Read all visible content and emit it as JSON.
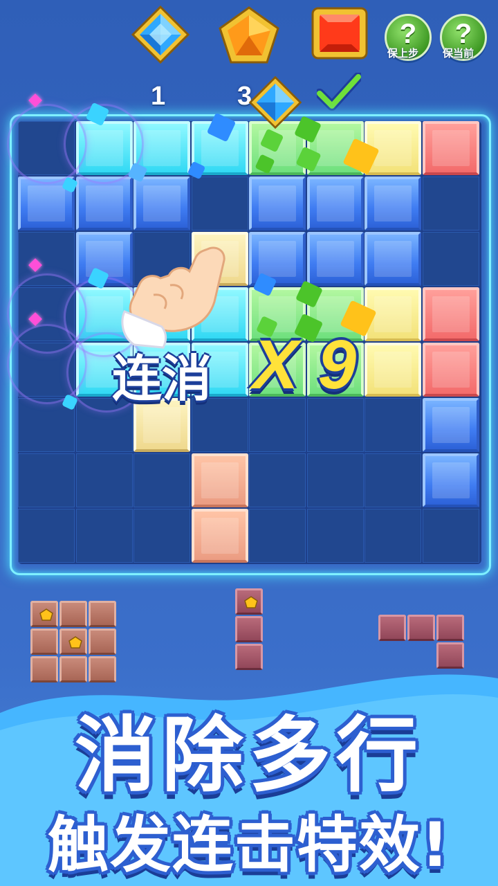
{
  "goals": [
    {
      "icon": "blue-diamond-gem-icon",
      "count": "1"
    },
    {
      "icon": "orange-pentagon-gem-icon",
      "count": "3"
    },
    {
      "icon": "red-square-gem-icon",
      "count": "completed"
    }
  ],
  "buttons": {
    "hint_symbol": "?",
    "save_previous_label": "保上步",
    "save_current_label": "保当前"
  },
  "combo": {
    "label": "连消",
    "multiplier": "X 9"
  },
  "banner": {
    "line1": "消除多行",
    "line2": "触发连击特效!"
  },
  "colors": {
    "background": "#3566c2",
    "board": "#1e3f8a",
    "neon_frame": "#4fe6ff",
    "combo_multiplier": "#ffe23a"
  }
}
